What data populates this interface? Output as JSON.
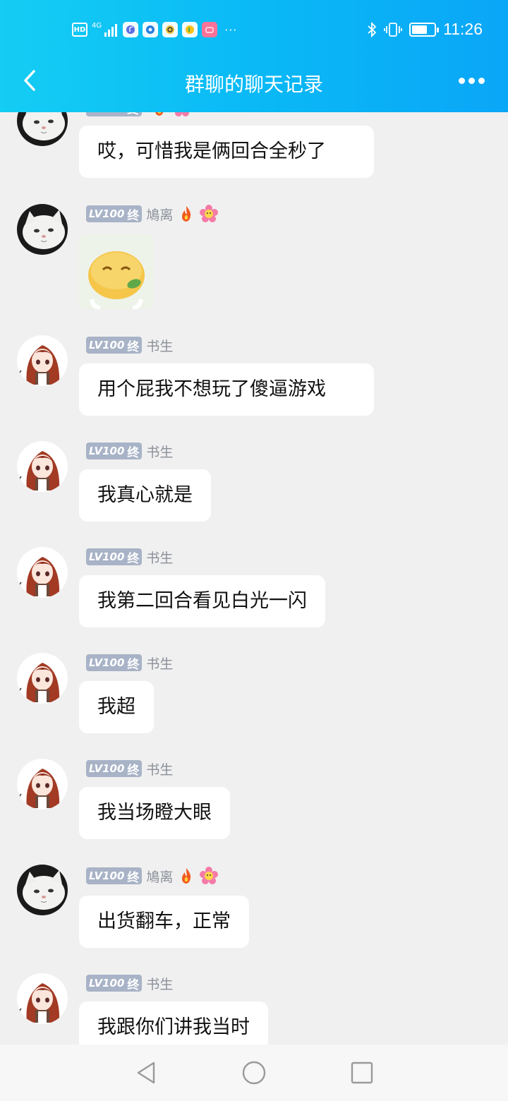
{
  "status_bar": {
    "hd": "HD",
    "network": "4G",
    "time": "11:26",
    "battery_level": 0.7,
    "app_icons": [
      "music-app-icon",
      "browser-app-icon",
      "qq-browser-icon",
      "qq-music-icon",
      "bilibili-icon"
    ],
    "more": "···"
  },
  "header": {
    "title": "群聊的聊天记录",
    "back_icon": "chevron-left-icon",
    "more_icon": "more-dots-icon",
    "color": "#0ab9f6"
  },
  "level_badge": {
    "level": "LV100",
    "end": "终"
  },
  "messages": [
    {
      "avatar": "cat",
      "name": "",
      "text": "哎，可惜我是俩回合全秒了"
    },
    {
      "avatar": "cat",
      "name": "鳩离",
      "sticker": "smiling-orange-sticker"
    },
    {
      "avatar": "girl",
      "name": "书生",
      "text": "用个屁我不想玩了傻逼游戏"
    },
    {
      "avatar": "girl",
      "name": "书生",
      "text": "我真心就是"
    },
    {
      "avatar": "girl",
      "name": "书生",
      "text": "我第二回合看见白光一闪"
    },
    {
      "avatar": "girl",
      "name": "书生",
      "text": "我超"
    },
    {
      "avatar": "girl",
      "name": "书生",
      "text": "我当场瞪大眼"
    },
    {
      "avatar": "cat",
      "name": "鳩离",
      "text": "出货翻车，正常"
    },
    {
      "avatar": "girl",
      "name": "书生",
      "text": "我跟你们讲我当时"
    }
  ],
  "nav_bar": {
    "icons": [
      "nav-back-icon",
      "nav-home-icon",
      "nav-recent-icon"
    ]
  }
}
